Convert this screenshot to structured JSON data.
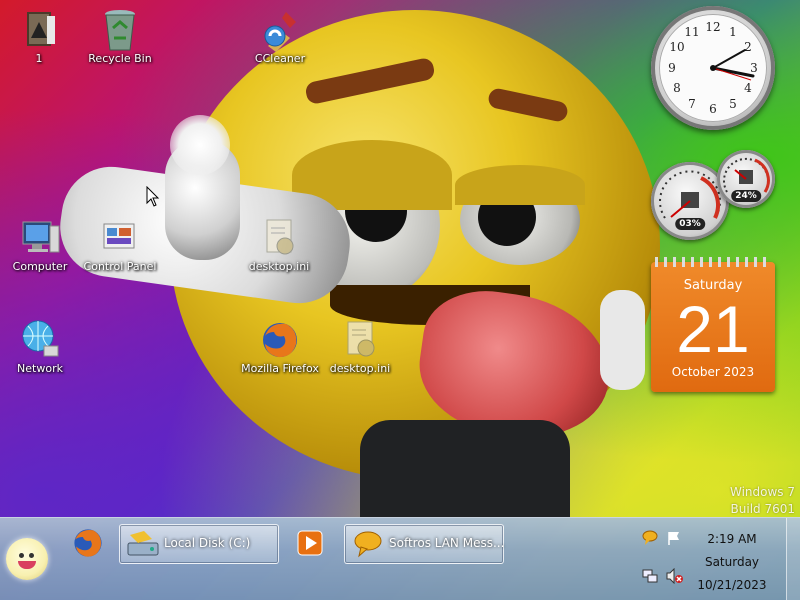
{
  "desktop": {
    "icons": [
      {
        "label": "1"
      },
      {
        "label": "Recycle Bin"
      },
      {
        "label": "CCleaner"
      },
      {
        "label": "Computer"
      },
      {
        "label": "Control Panel"
      },
      {
        "label": "desktop.ini"
      },
      {
        "label": "Network"
      },
      {
        "label": "Mozilla Firefox"
      },
      {
        "label": "desktop.ini"
      }
    ],
    "watermark": {
      "line1": "Windows 7",
      "line2": "Build 7601"
    }
  },
  "gadgets": {
    "clock": {
      "numerals": [
        "12",
        "1",
        "2",
        "3",
        "4",
        "5",
        "6",
        "7",
        "8",
        "9",
        "10",
        "11"
      ]
    },
    "cpu_meter": {
      "cpu": "03%",
      "memory": "24%"
    },
    "calendar": {
      "weekday": "Saturday",
      "day": "21",
      "month_year": "October 2023"
    }
  },
  "taskbar": {
    "tasks": [
      {
        "label": "Local Disk (C:)"
      },
      {
        "label": "Softros LAN Mess..."
      }
    ],
    "clock": {
      "time": "2:19 AM",
      "weekday": "Saturday",
      "date": "10/21/2023"
    }
  },
  "colors": {
    "calendar_bg": "#e8761a",
    "taskbar_bg": "#8ca5c3"
  }
}
